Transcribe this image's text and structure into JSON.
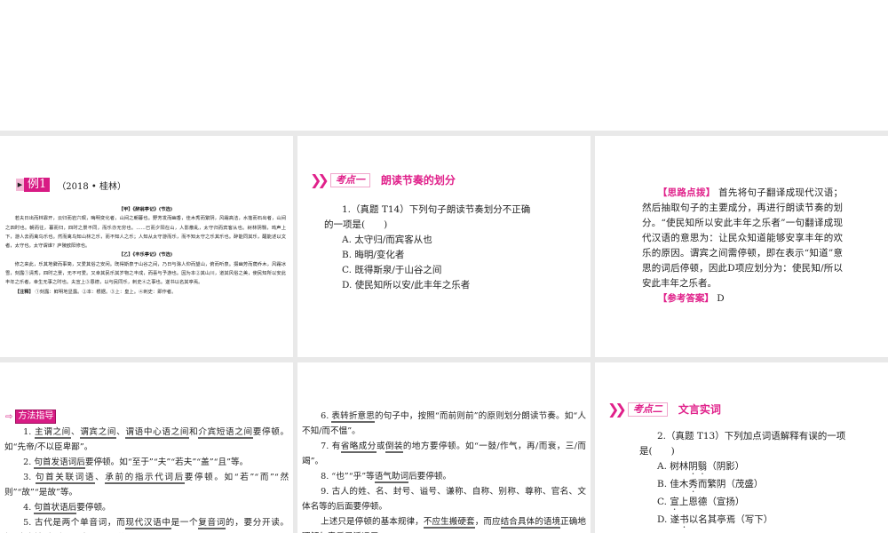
{
  "slide1": {
    "badge": "例1",
    "source": "（2018 • 桂林）",
    "jia_title": "【甲】《醉翁亭记》(节选)",
    "jia_text": "若夫日出而林霏开，云归而岩穴暝，晦明变化者，山间之朝暮也。野芳发而幽香，佳木秀而繁阴，风霜高洁，水落而石出者，山间之四时也。朝而往，暮而归，四时之景不同，而乐亦无穷也。……已而夕阳在山，人影散乱，太守归而宾客从也。树林阴翳，鸣声上下，游人去而禽鸟乐也。然而禽鸟知山林之乐，而不知人之乐；人知从太守游而乐，而不知太守之乐其乐也。醉能同其乐，醒能述以文者，太守也。太守谓谁？庐陵欧阳修也。",
    "yi_title": "【乙】《丰乐亭记》(节选)",
    "yi_text": "修之来此，乐其地僻而事简，又爱其俗之安闲。既得斯泉于山谷之间，乃日与滁人仰而望山，俯而听泉。掇幽芳而荫乔木，风霜冰雪，刻露①清秀，四时之景，无不可爱。又幸其民乐其岁物之丰成，而喜与予游也。因为本②其山川，道其风俗之美，使民知所以安此丰年之乐者，幸生无事之时也。夫宣上③恩德，以与民同乐，刺史④之事也。遂书以名其亭焉。",
    "note_label": "【注释】",
    "note_text": "①刻露：鲜明地显露。②本：根据。③上：皇上。④刺史：即作者。"
  },
  "slide2": {
    "kaodian": "考点一",
    "title": "朗读节奏的划分",
    "question": "1.（真题 T14）下列句子朗读节奏划分不正确",
    "question_cont": "的一项是(　　)",
    "options": [
      "A. 太守归/而宾客从也",
      "B. 晦明/变化者",
      "C. 既得斯泉/于山谷之间",
      "D. 使民知所以安/此丰年之乐者"
    ]
  },
  "slide3": {
    "hint_label": "【思路点拨】",
    "hint_text": "首先将句子翻译成现代汉语；然后抽取句子的主要成分，再进行朗读节奏的划分。“使民知所以安此丰年之乐者”一句翻译成现代汉语的意思为：让民众知道能够安享丰年的欢乐的原因。谓宾之间需停顿，即在表示“知道”意思的词后停顿，因此D项应划分为：使民知/所以安此丰年之乐者。",
    "answer_label": "【参考答案】",
    "answer": "D"
  },
  "slide4": {
    "badge": "方法指导",
    "paras": [
      [
        {
          "t": "1. "
        },
        {
          "t": "主谓之间",
          "u": 1
        },
        {
          "t": "、"
        },
        {
          "t": "谓宾之间",
          "u": 1
        },
        {
          "t": "、"
        },
        {
          "t": "谓语中心语之间",
          "u": 1
        },
        {
          "t": "和"
        },
        {
          "t": "介宾短语之间",
          "u": 1
        },
        {
          "t": "要停顿。如“先帝/不以臣卑鄙”。"
        }
      ],
      [
        {
          "t": "2. "
        },
        {
          "t": "句首发语词后",
          "u": 1
        },
        {
          "t": "要停顿。如“至于”“夫”“若夫”“盖”“且”等。"
        }
      ],
      [
        {
          "t": "3. "
        },
        {
          "t": "句首关联词语",
          "u": 1
        },
        {
          "t": "、"
        },
        {
          "t": "承前的指示代词后",
          "u": 1
        },
        {
          "t": "要停顿。如“若”“而”“然则”“故”“是故”等。"
        }
      ],
      [
        {
          "t": "4. "
        },
        {
          "t": "句首状语后",
          "u": 1
        },
        {
          "t": "要停顿。"
        }
      ],
      [
        {
          "t": "5. 古代是两个单音词，而"
        },
        {
          "t": "现代汉语中",
          "u": 1
        },
        {
          "t": "是一个"
        },
        {
          "t": "复音词",
          "u": 1
        },
        {
          "t": "的，要分开读。如“今齐地/方千里”“今/天下三分”。"
        }
      ]
    ]
  },
  "slide5": {
    "paras": [
      [
        {
          "t": "6. "
        },
        {
          "t": "表转折意思",
          "u": 1
        },
        {
          "t": "的句子中，按照“而前则前”的原则划分朗读节奏。如“人不知/而不愠”。"
        }
      ],
      [
        {
          "t": "7. 有"
        },
        {
          "t": "省略成分",
          "u": 1
        },
        {
          "t": "或"
        },
        {
          "t": "倒装",
          "u": 1
        },
        {
          "t": "的地方要停顿。如“一鼓/作气，再/而衰，三/而竭”。"
        }
      ],
      [
        {
          "t": "8. “也”“乎”等"
        },
        {
          "t": "语气助词",
          "u": 1
        },
        {
          "t": "后要停顿。"
        }
      ],
      [
        {
          "t": "9. 古人的姓、名、封号、谥号、谦称、自称、别称、尊称、官名、文体名等的后面要停顿。"
        }
      ],
      [
        {
          "t": "上述只是停顿的基本规律，"
        },
        {
          "t": "不应生搬硬套",
          "u": 1
        },
        {
          "t": "，而应"
        },
        {
          "t": "结合具体的语境",
          "u": 1
        },
        {
          "t": "正确地理解句意后灵活运用。"
        }
      ]
    ]
  },
  "slide6": {
    "kaodian": "考点二",
    "title": "文言实词",
    "question": "2.（真题 T13）下列加点词语解释有误的一项",
    "question_cont": "是(　　)",
    "options": [
      [
        {
          "t": "A. 树林"
        },
        {
          "t": "阴翳",
          "d": 1
        },
        {
          "t": "（阴影）"
        }
      ],
      [
        {
          "t": "B. 佳木"
        },
        {
          "t": "秀",
          "d": 1
        },
        {
          "t": "而繁阴（茂盛）"
        }
      ],
      [
        {
          "t": "C. "
        },
        {
          "t": "宣",
          "d": 1
        },
        {
          "t": "上恩德（宣扬）"
        }
      ],
      [
        {
          "t": "D. 遂"
        },
        {
          "t": "书",
          "d": 1
        },
        {
          "t": "以名其亭焉（写下）"
        }
      ]
    ]
  }
}
